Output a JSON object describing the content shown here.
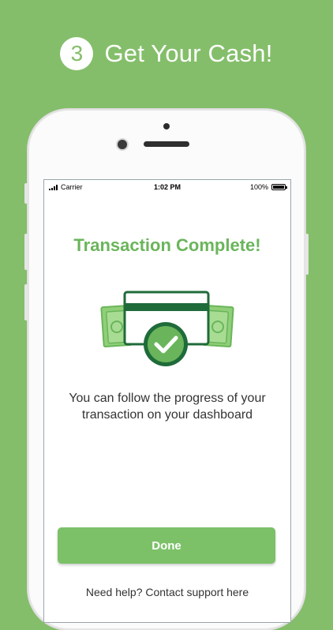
{
  "promo": {
    "step_number": "3",
    "title": "Get Your Cash!"
  },
  "status_bar": {
    "carrier": "Carrier",
    "time": "1:02 PM",
    "battery": "100%"
  },
  "screen": {
    "title": "Transaction Complete!",
    "message": "You can follow the progress of your transaction on your dashboard",
    "done_label": "Done",
    "bottom_link": "Need help? Contact support here"
  },
  "colors": {
    "background": "#84be6a",
    "title_green": "#6ab55b",
    "button_green": "#7cc168",
    "icon_dark_green": "#1f6b3a",
    "icon_light_green": "#8fcf78"
  },
  "icons": {
    "step_badge": "number-three-badge",
    "illustration": "card-cash-check-icon"
  }
}
